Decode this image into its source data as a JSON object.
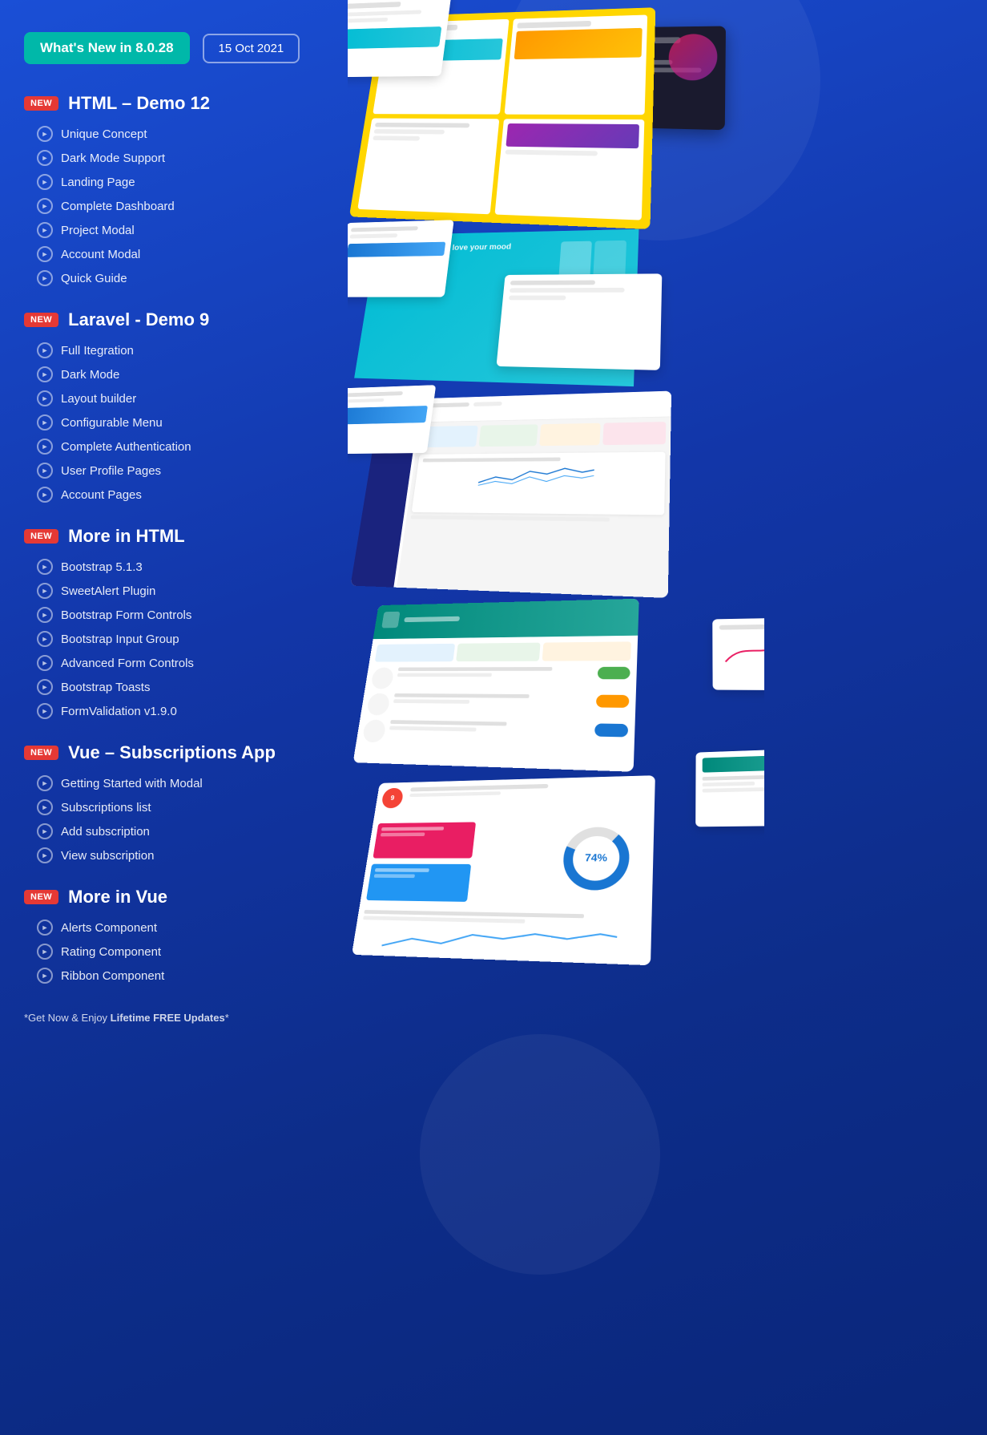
{
  "header": {
    "badge_text": "What's New in 8.0.28",
    "date_text": "15 Oct 2021"
  },
  "sections": [
    {
      "id": "html-demo",
      "new_badge": "New",
      "title": "HTML – Demo 12",
      "items": [
        "Unique Concept",
        "Dark Mode Support",
        "Landing Page",
        "Complete Dashboard",
        "Project Modal",
        "Account Modal",
        "Quick Guide"
      ]
    },
    {
      "id": "laravel-demo",
      "new_badge": "New",
      "title": "Laravel - Demo 9",
      "items": [
        "Full Itegration",
        "Dark Mode",
        "Layout builder",
        "Configurable Menu",
        "Complete Authentication",
        "User Profile Pages",
        "Account Pages"
      ]
    },
    {
      "id": "more-html",
      "new_badge": "New",
      "title": "More in HTML",
      "items": [
        "Bootstrap 5.1.3",
        "SweetAlert Plugin",
        "Bootstrap Form Controls",
        "Bootstrap Input Group",
        "Advanced Form Controls",
        "Bootstrap Toasts",
        "FormValidation v1.9.0"
      ]
    },
    {
      "id": "vue-subscriptions",
      "new_badge": "New",
      "title": "Vue – Subscriptions App",
      "items": [
        "Getting Started with Modal",
        "Subscriptions list",
        "Add subscription",
        "View subscription"
      ]
    },
    {
      "id": "more-vue",
      "new_badge": "New",
      "title": "More in Vue",
      "items": [
        "Alerts Component",
        "Rating Component",
        "Ribbon Component"
      ]
    }
  ],
  "footer": {
    "text_prefix": "*Get Now & Enjoy ",
    "bold_text": "Lifetime FREE Updates",
    "text_suffix": "*"
  },
  "colors": {
    "teal_badge": "#00b8a9",
    "red_badge": "#e53935",
    "dark_bg": "#1a1a2e",
    "yellow_section": "#FFD600",
    "cyan_section": "#00bcd4"
  }
}
